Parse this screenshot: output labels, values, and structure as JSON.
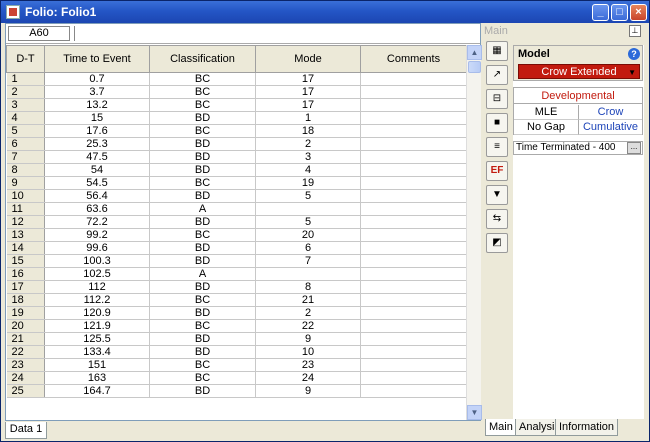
{
  "window": {
    "title": "Folio: Folio1"
  },
  "titlebar_buttons": {
    "minimize": "_",
    "maximize": "□",
    "close": "×"
  },
  "sheet": {
    "cell_ref": "A60"
  },
  "columns": [
    "D-T",
    "Time to Event",
    "Classification",
    "Mode",
    "Comments"
  ],
  "rows": [
    [
      "1",
      "0.7",
      "BC",
      "17",
      ""
    ],
    [
      "2",
      "3.7",
      "BC",
      "17",
      ""
    ],
    [
      "3",
      "13.2",
      "BC",
      "17",
      ""
    ],
    [
      "4",
      "15",
      "BD",
      "1",
      ""
    ],
    [
      "5",
      "17.6",
      "BC",
      "18",
      ""
    ],
    [
      "6",
      "25.3",
      "BD",
      "2",
      ""
    ],
    [
      "7",
      "47.5",
      "BD",
      "3",
      ""
    ],
    [
      "8",
      "54",
      "BD",
      "4",
      ""
    ],
    [
      "9",
      "54.5",
      "BC",
      "19",
      ""
    ],
    [
      "10",
      "56.4",
      "BD",
      "5",
      ""
    ],
    [
      "11",
      "63.6",
      "A",
      "",
      ""
    ],
    [
      "12",
      "72.2",
      "BD",
      "5",
      ""
    ],
    [
      "13",
      "99.2",
      "BC",
      "20",
      ""
    ],
    [
      "14",
      "99.6",
      "BD",
      "6",
      ""
    ],
    [
      "15",
      "100.3",
      "BD",
      "7",
      ""
    ],
    [
      "16",
      "102.5",
      "A",
      "",
      ""
    ],
    [
      "17",
      "112",
      "BD",
      "8",
      ""
    ],
    [
      "18",
      "112.2",
      "BC",
      "21",
      ""
    ],
    [
      "19",
      "120.9",
      "BD",
      "2",
      ""
    ],
    [
      "20",
      "121.9",
      "BC",
      "22",
      ""
    ],
    [
      "21",
      "125.5",
      "BD",
      "9",
      ""
    ],
    [
      "22",
      "133.4",
      "BD",
      "10",
      ""
    ],
    [
      "23",
      "151",
      "BC",
      "23",
      ""
    ],
    [
      "24",
      "163",
      "BC",
      "24",
      ""
    ],
    [
      "25",
      "164.7",
      "BD",
      "9",
      ""
    ]
  ],
  "bottom_tab": "Data 1",
  "panel": {
    "header": "Main",
    "model_label": "Model",
    "model_value": "Crow Extended",
    "help_glyph": "?",
    "developmental": "Developmental",
    "options": [
      [
        "MLE",
        "Crow"
      ],
      [
        "No Gap",
        "Cumulative"
      ]
    ],
    "method": "Time Terminated - 400",
    "method_button": "...",
    "tabs": [
      "Main",
      "Analysis",
      "Information"
    ]
  },
  "tools": [
    {
      "name": "data-icon",
      "glyph": "▦"
    },
    {
      "name": "plot-icon",
      "glyph": "↗"
    },
    {
      "name": "gof-icon",
      "glyph": "⊟"
    },
    {
      "name": "blank-icon",
      "glyph": "■"
    },
    {
      "name": "list-icon",
      "glyph": "≡"
    },
    {
      "name": "ef-icon",
      "glyph": "EF"
    },
    {
      "name": "filter-icon",
      "glyph": "▼"
    },
    {
      "name": "transfer-icon",
      "glyph": "⇆"
    },
    {
      "name": "chart-icon",
      "glyph": "◩"
    }
  ],
  "colors": {
    "accent_red": "#c21a0e",
    "link_blue": "#1d44b8",
    "title_blue": "#2456c6"
  }
}
